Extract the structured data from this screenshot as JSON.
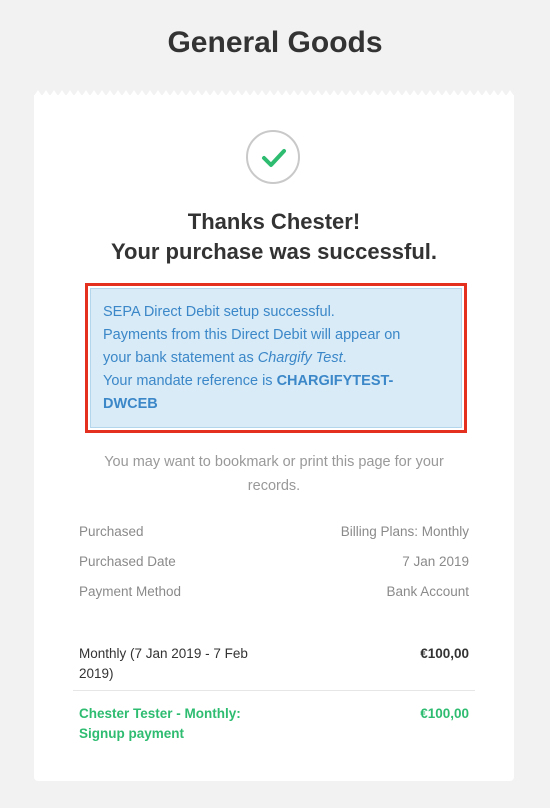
{
  "store": {
    "name": "General Goods"
  },
  "confirmation": {
    "line1": "Thanks Chester!",
    "line2": "Your purchase was successful."
  },
  "notice": {
    "line1": "SEPA Direct Debit setup successful.",
    "line2": "Payments from this Direct Debit will appear on",
    "line3_prefix": "your bank statement as ",
    "line3_em": "Chargify Test",
    "line3_suffix": ".",
    "line4_prefix": "Your mandate reference is ",
    "mandate_part1": "CHARGIFYTEST-",
    "mandate_part2": "DWCEB",
    "highlight_color": "#e3301f"
  },
  "bookmark": {
    "line1": "You may want to bookmark or print this page for your",
    "line2": "records."
  },
  "details": [
    {
      "label": "Purchased",
      "value": "Billing Plans: Monthly"
    },
    {
      "label": "Purchased Date",
      "value": "7 Jan 2019"
    },
    {
      "label": "Payment Method",
      "value": "Bank Account"
    }
  ],
  "line_items": [
    {
      "desc_line1": "Monthly (7 Jan 2019 - 7 Feb",
      "desc_line2": "2019)",
      "amount": "€100,00"
    },
    {
      "desc_line1": "Chester Tester - Monthly:",
      "desc_line2": "Signup payment",
      "amount": "€100,00"
    }
  ],
  "icons": {
    "success": "checkmark-icon"
  },
  "colors": {
    "success": "#2ebc71",
    "info_text": "#3b87c8",
    "info_bg": "#d8ebf7"
  }
}
